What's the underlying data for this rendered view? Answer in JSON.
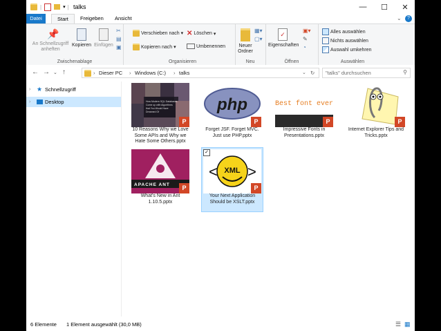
{
  "title": "talks",
  "tabs": [
    "Datei",
    "Start",
    "Freigeben",
    "Ansicht"
  ],
  "ribbon": {
    "clipboard": {
      "label": "Zwischenablage",
      "pin": "An Schnellzugriff anheften",
      "copy": "Kopieren",
      "paste": "Einfügen"
    },
    "organize": {
      "label": "Organisieren",
      "move": "Verschieben nach",
      "copy_to": "Kopieren nach",
      "delete": "Löschen",
      "rename": "Umbenennen"
    },
    "new": {
      "label": "Neu",
      "new_folder": "Neuer Ordner"
    },
    "open": {
      "label": "Öffnen",
      "properties": "Eigenschaften"
    },
    "select": {
      "label": "Auswählen",
      "select_all": "Alles auswählen",
      "select_none": "Nichts auswählen",
      "invert": "Auswahl umkehren"
    }
  },
  "address": {
    "crumbs": [
      "Dieser PC",
      "Windows (C:)",
      "talks"
    ],
    "search_placeholder": "\"talks\" durchsuchen"
  },
  "nav": {
    "quick": "Schnellzugriff",
    "desktop": "Desktop"
  },
  "files": [
    {
      "name": "10 Reasons Why we Love Some APIs and Why we Hate Some Others.pptx",
      "selected": false
    },
    {
      "name": "Forget JSF. Forget MVC. Just use PHP.pptx",
      "selected": false,
      "thumb_text": "php"
    },
    {
      "name": "Impressive Fonts in Presentations.pptx",
      "selected": false,
      "thumb_text": "Best font ever"
    },
    {
      "name": "Internet Explorer Tips and Tricks.pptx",
      "selected": false
    },
    {
      "name": "What's New in Ant 1.10.5.pptx",
      "selected": false,
      "thumb_text": "APACHE ANT"
    },
    {
      "name": "Your Next Application Should be XSLT.pptx",
      "selected": true,
      "thumb_text": "XML"
    }
  ],
  "status": {
    "count": "6 Elemente",
    "selection": "1 Element ausgewählt (30,0 MB)"
  },
  "colors": {
    "accent": "#1979ca",
    "selection": "#cce8ff",
    "ppt": "#d24726"
  }
}
